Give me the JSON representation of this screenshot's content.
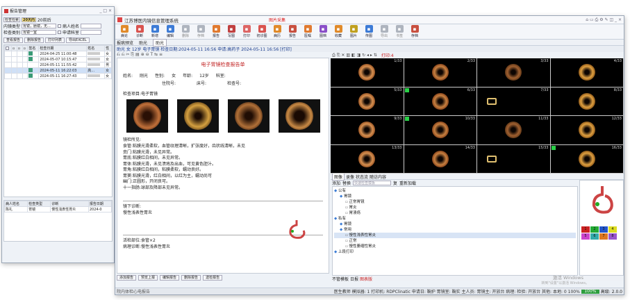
{
  "w1": {
    "title": "报告管理",
    "filter_row1": [
      "检查检索",
      "20天内",
      "20前后"
    ],
    "row2_label": "内镜类型",
    "row2_value": "胃镜，肠镜，无...",
    "row2_lbl2": "病人姓名",
    "row3_label": "检查类别",
    "row3_value": "胃镜一室",
    "row3_lbl2": "申请科室",
    "buttons": [
      "查看报告",
      "删除报告",
      "打印列表",
      "导出EXCEL"
    ],
    "list_headers": [
      "",
      "",
      "",
      "",
      "签名",
      "检查日期",
      "姓名",
      "性"
    ],
    "rows": [
      {
        "date": "2024-04-25 11:00:48",
        "sex": "女"
      },
      {
        "date": "2024-05-07 10:15:47",
        "sex": "女"
      },
      {
        "date": "2024-05-11 11:55:42",
        "sex": "男"
      },
      {
        "date": "2024-05-11 16:22:03",
        "sex": "女",
        "name": "高...",
        "selected": true
      },
      {
        "date": "2024-05-11 16:27:43",
        "sex": "女"
      }
    ],
    "bottom_headers": [
      "病人姓名",
      "检查类型",
      "诊断",
      "报告日期"
    ],
    "bottom_row": [
      "陈礼",
      "胃镜",
      "慢性浅表性胃炎",
      "2024-0"
    ]
  },
  "w2": {
    "title": "江苏博医内镜信息管理系统",
    "alert": "图片采集",
    "toolbar": [
      "病论",
      "诊断",
      "新增",
      "编辑",
      "删除",
      "存档",
      "报告",
      "写图",
      "打印",
      "初诊图",
      "病历",
      "报告",
      "医嘱",
      "图档",
      "收藏",
      "图片",
      "传图",
      "导出",
      "书签",
      "存档"
    ],
    "tabs": [
      "报病预览",
      "助光",
      "助光"
    ],
    "patient_bar": "助光 女 12岁 电子胃镜 检查日期:2024-05-11 16:56 申请:高药子 2024-05-11 16:56 [打印]",
    "report": {
      "title": "电子胃镜检查报告单",
      "name_lbl": "姓名:",
      "name": "刚光",
      "sex_lbl": "性别:",
      "sex": "女",
      "age_lbl": "年龄:",
      "age": "12岁",
      "dept_lbl": "科室:",
      "bed_lbl": "住院号:",
      "bed": "",
      "ward_lbl": "床号:",
      "exam_no_lbl": "检查号:",
      "item_lbl": "检查项目:",
      "item": "电子胃镜",
      "findings_lbl": "镜检所见:",
      "findings": [
        "食管:粘膜光滑柔软，血管纹理清晰，扩张度好，齿状线清晰，未见",
        "贲门:粘膜光滑，未见异常。",
        "胃底:粘膜红白相间，未见异常。",
        "胃体:粘膜光滑，未见溃疡及出血，可见黄色胆汁。",
        "胃角:粘膜红白相间，粘膜柔软，蠕动良好。",
        "胃窦:粘膜光滑，红白相间，以红为主，蠕动尚可",
        "幽门:正圆形，开闭良可。",
        "十一指肠:球部及降部未见异常。"
      ],
      "diag_lbl": "镜下诊断:",
      "diag": "慢性浅表性胃炎",
      "site_lbl": "活检部位:",
      "site": "食管×2",
      "biopsy_lbl": "病理诊断:",
      "biopsy": "慢性浅表性胃炎"
    },
    "report_buttons": [
      "添加报告",
      "预览上报",
      "编辑报告",
      "删除报告",
      "送检报告"
    ],
    "img_toolbar": "打印:4",
    "thumbs": [
      "1/33",
      "2/33",
      "3/33",
      "4/33",
      "5/33",
      "6/33",
      "7/33",
      "8/33",
      "9/33",
      "10/33",
      "11/33",
      "12/33",
      "13/33",
      "14/33",
      "15/33",
      "16/33"
    ],
    "img_tabs": [
      "图像",
      "录像",
      "状态流",
      "随访内容"
    ],
    "tpl_bar": [
      "添加",
      "替换",
      "快速检查模板",
      "复",
      "重新加载"
    ],
    "tree": [
      "公有",
      "胃镜",
      "正常胃镜",
      "胃炎",
      "胃溃疡",
      "私有",
      "胃镜",
      "常用",
      "慢性浅表性胃炎",
      "正常",
      "慢性萎缩性胃炎",
      "上段打印"
    ],
    "status_left": [
      "不管模板",
      "日报",
      "图表版"
    ],
    "watermark1": "激活 Windows",
    "watermark2": "转到\"设置\"以激活 Windows。",
    "status": "医生教师  模拟器: 1  打印机: RDPClinatic  申请日: 鞠护  胃镜室: 鞠实  主人员: 胃镜主: 开放台  病理:  检验: 开放台  其他:  本地: 0 100%",
    "status_pct": "100%",
    "status_right": "高级: 2.0.0",
    "color_grid": [
      "1",
      "2",
      "3",
      "4",
      "5",
      "6",
      "7",
      "8"
    ],
    "color_grid_colors": [
      "#cc2222",
      "#22aa33",
      "#2255cc",
      "#dddd22",
      "#cc44cc",
      "#33aaaa",
      "#dd7722",
      "#9955cc"
    ],
    "bottom_left": "院内体检心电报告"
  }
}
